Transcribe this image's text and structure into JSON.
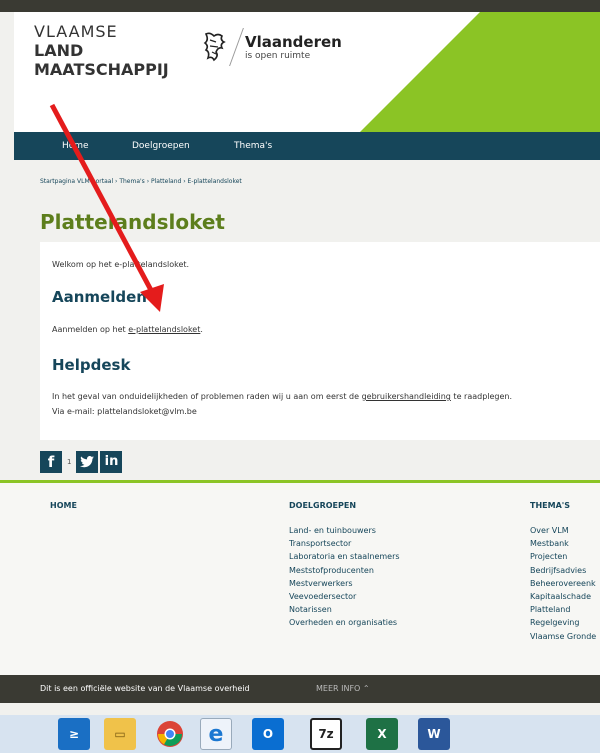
{
  "header": {
    "vlm_line1": "VLAAMSE",
    "vlm_line2": "LAND",
    "vlm_line3": "MAATSCHAPPIJ",
    "vlaanderen": "Vlaanderen",
    "tagline": "is open ruimte"
  },
  "nav": [
    "Home",
    "Doelgroepen",
    "Thema's"
  ],
  "breadcrumb": "Startpagina VLM-portaal › Thema's › Platteland › E-plattelandsloket",
  "page_title": "Plattelandsloket",
  "content": {
    "welcome": "Welkom op het e-plattelandsloket.",
    "aanmelden_heading": "Aanmelden",
    "aanmelden_prefix": "Aanmelden op het ",
    "aanmelden_link": "e-plattelandsloket",
    "aanmelden_suffix": ".",
    "helpdesk_heading": "Helpdesk",
    "helpdesk_prefix": "In het geval van onduidelijkheden of problemen raden wij u aan om eerst de ",
    "helpdesk_link": "gebruikershandleiding",
    "helpdesk_suffix": " te raadplegen.",
    "email_line": "Via e-mail: plattelandsloket@vlm.be"
  },
  "social": {
    "fb_count": "1"
  },
  "footer": {
    "col1_title": "HOME",
    "col2_title": "DOELGROEPEN",
    "col2_items": [
      "Land- en tuinbouwers",
      "Transportsector",
      "Laboratoria en staalnemers",
      "Meststofproducenten",
      "Mestverwerkers",
      "Veevoedersector",
      "Notarissen",
      "Overheden en organisaties"
    ],
    "col3_title": "THEMA'S",
    "col3_items": [
      "Over VLM",
      "Mestbank",
      "Projecten",
      "Bedrijfsadvies",
      "Beheerovereenk",
      "Kapitaalschade",
      "Platteland",
      "Regelgeving",
      "Vlaamse Gronde"
    ]
  },
  "official": {
    "text": "Dit is een officiële website van de Vlaamse overheid",
    "more": "MEER INFO"
  },
  "colors": {
    "green": "#8bc425",
    "navy": "#16465a",
    "title_green": "#5d7e1c",
    "annotation_red": "#e41c1c"
  }
}
